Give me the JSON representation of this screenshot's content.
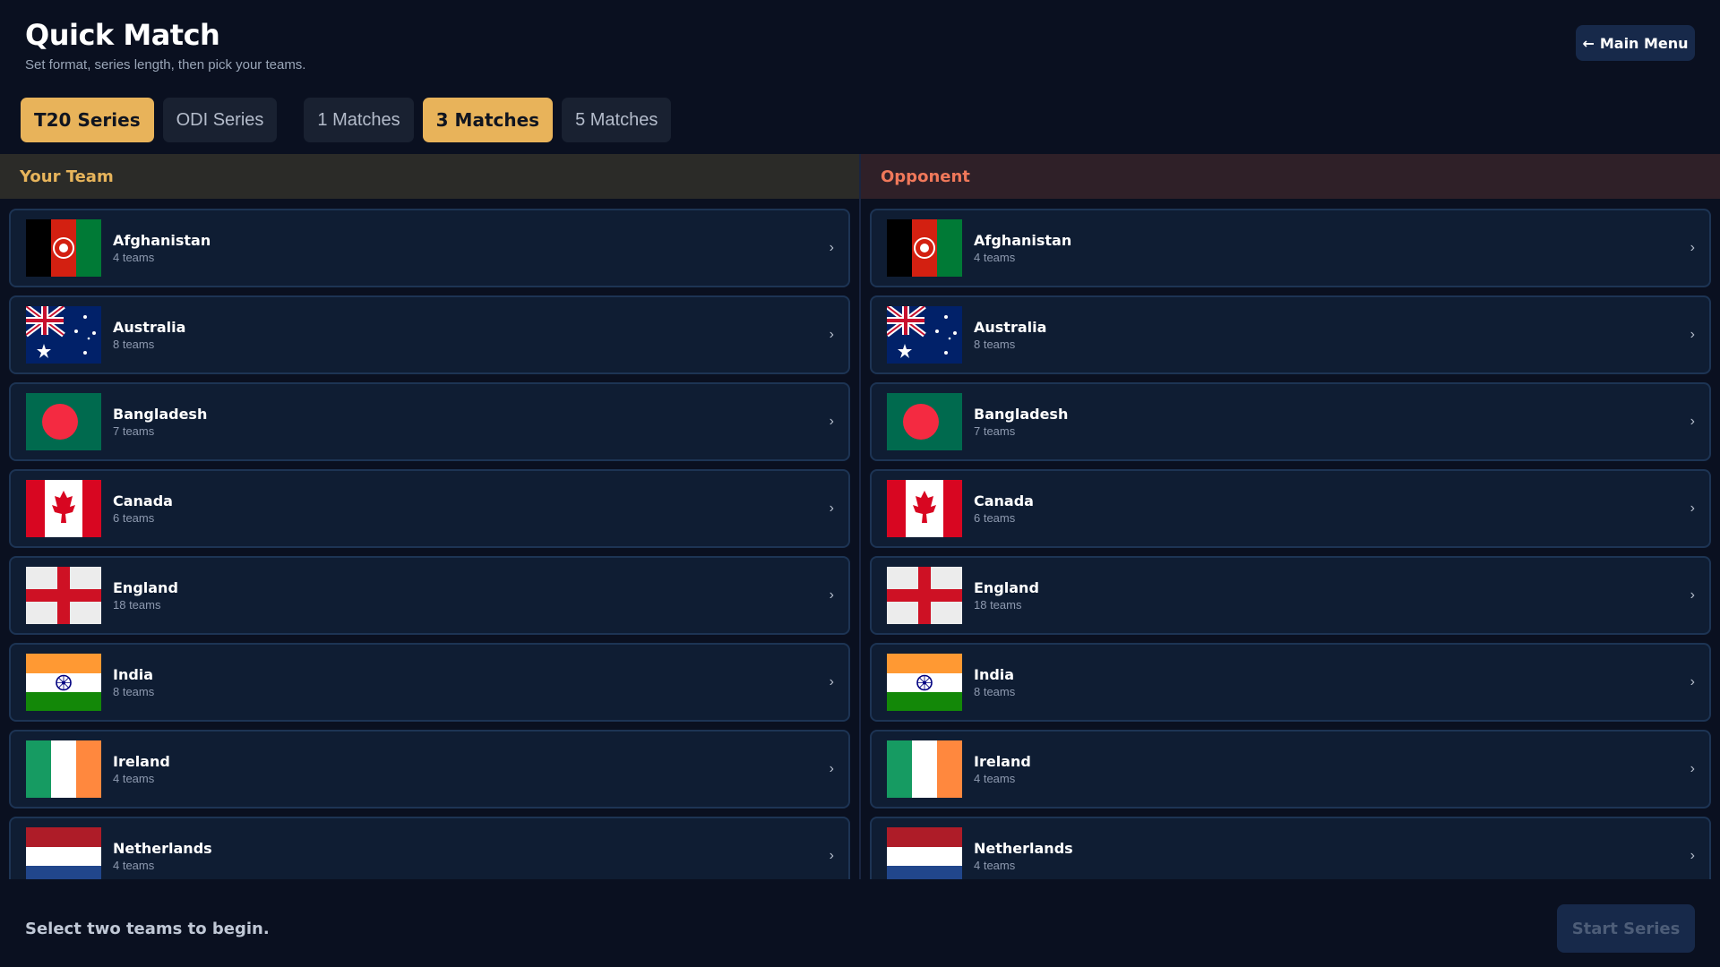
{
  "header": {
    "title": "Quick Match",
    "subtitle": "Set format, series length, then pick your teams.",
    "menu_arrow": "←",
    "menu_label": "Main Menu"
  },
  "format_options": [
    {
      "label": "T20 Series",
      "selected": true
    },
    {
      "label": "ODI Series",
      "selected": false
    }
  ],
  "length_options": [
    {
      "label": "1 Matches",
      "selected": false
    },
    {
      "label": "3 Matches",
      "selected": true
    },
    {
      "label": "5 Matches",
      "selected": false
    }
  ],
  "columns": {
    "your_team": "Your Team",
    "opponent": "Opponent"
  },
  "countries": [
    {
      "name": "Afghanistan",
      "count": "4 teams",
      "flag": "afghanistan-flag"
    },
    {
      "name": "Australia",
      "count": "8 teams",
      "flag": "australia-flag"
    },
    {
      "name": "Bangladesh",
      "count": "7 teams",
      "flag": "bangladesh-flag"
    },
    {
      "name": "Canada",
      "count": "6 teams",
      "flag": "canada-flag"
    },
    {
      "name": "England",
      "count": "18 teams",
      "flag": "england-flag"
    },
    {
      "name": "India",
      "count": "8 teams",
      "flag": "india-flag"
    },
    {
      "name": "Ireland",
      "count": "4 teams",
      "flag": "ireland-flag"
    },
    {
      "name": "Netherlands",
      "count": "4 teams",
      "flag": "netherlands-flag"
    }
  ],
  "chevron": "›",
  "footer": {
    "status": "Select two teams to begin.",
    "start_label": "Start Series"
  },
  "colors": {
    "accent": "#e8b35a",
    "opponent_accent": "#f0785a",
    "background": "#0a1020"
  }
}
